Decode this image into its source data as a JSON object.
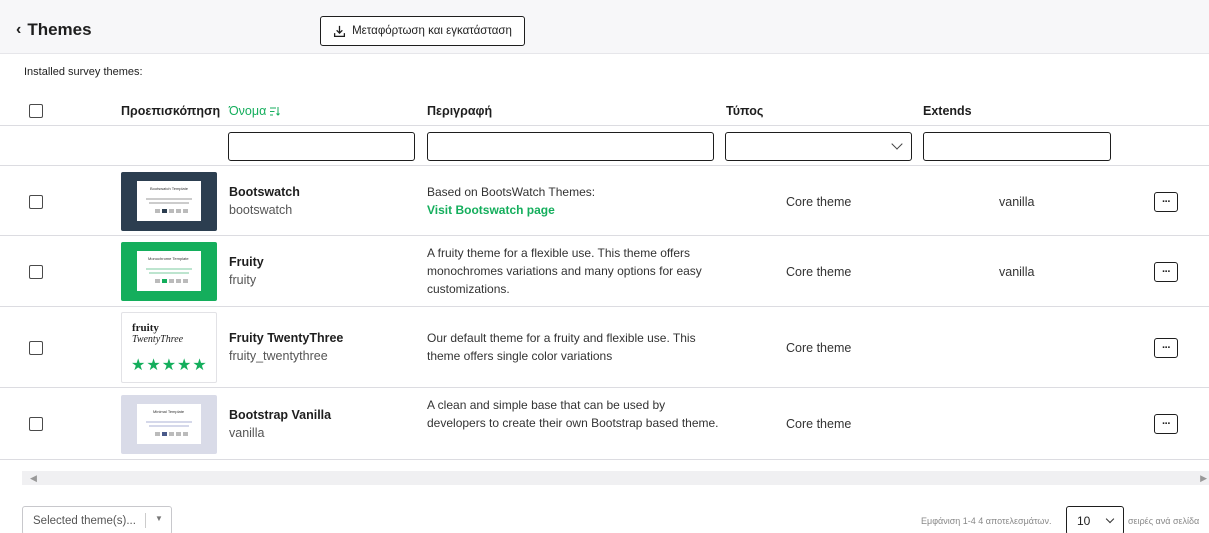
{
  "header": {
    "back_chevron": "‹",
    "title": "Themes",
    "upload_button": "Μεταφόρτωση και εγκατάσταση"
  },
  "section_label": "Installed survey themes:",
  "columns": {
    "preview": "Προεπισκόπηση",
    "name": "Όνομα",
    "description": "Περιγραφή",
    "type": "Τύπος",
    "extends": "Extends"
  },
  "rows": [
    {
      "title": "Bootswatch",
      "name": "bootswatch",
      "description": "Based on BootsWatch Themes:",
      "link": "Visit Bootswatch page",
      "type": "Core theme",
      "extends": "vanilla",
      "thumb_title": "Bootswatch Template"
    },
    {
      "title": "Fruity",
      "name": "fruity",
      "description": "A fruity theme for a flexible use. This theme offers monochromes variations and many options for easy customizations.",
      "type": "Core theme",
      "extends": "vanilla",
      "thumb_title": "Monochrome Template"
    },
    {
      "title": "Fruity TwentyThree",
      "name": "fruity_twentythree",
      "description": "Our default theme for a fruity and flexible use. This theme offers single color variations",
      "type": "Core theme",
      "extends": "",
      "thumb_line1": "fruity",
      "thumb_line2": "TwentyThree",
      "thumb_stars": "★★★★★"
    },
    {
      "title": "Bootstrap Vanilla",
      "name": "vanilla",
      "description": "A clean and simple base that can be used by developers to create their own Bootstrap based theme.",
      "type": "Core theme",
      "extends": "",
      "thumb_title": "Minimal Template"
    }
  ],
  "footer": {
    "bulk_select": "Selected theme(s)...",
    "paging_text": "Εμφάνιση 1-4 4 αποτελεσμάτων.",
    "page_size": "10",
    "per_page_text": "σειρές ανά σελίδα"
  },
  "colors": {
    "accent_green": "#14ae5c",
    "bootswatch_bg": "#2c3e50",
    "fruity_bg": "#14ae5c",
    "vanilla_bg": "#d9dbe8"
  },
  "icons": {
    "upload": "download-tray-icon",
    "sort": "sort-icon",
    "more": "ellipsis-icon"
  }
}
